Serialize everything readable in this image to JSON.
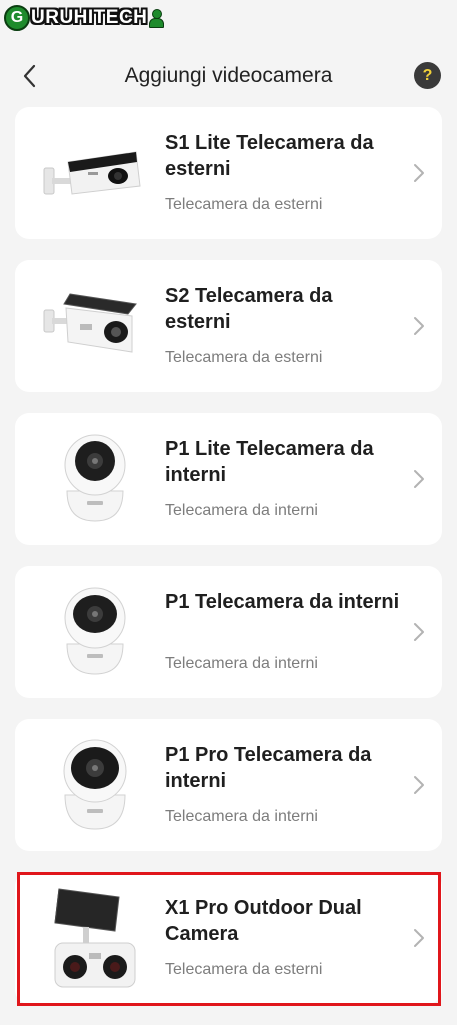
{
  "watermark": {
    "logo_letter": "G",
    "text": "URUHITECH"
  },
  "header": {
    "title": "Aggiungi videocamera",
    "help_label": "?"
  },
  "cameras": [
    {
      "name": "S1 Lite Telecamera da esterni",
      "type": "Telecamera da esterni",
      "icon": "outdoor-bullet-camera-icon"
    },
    {
      "name": "S2 Telecamera da esterni",
      "type": "Telecamera da esterni",
      "icon": "outdoor-solar-bullet-camera-icon"
    },
    {
      "name": "P1 Lite Telecamera da interni",
      "type": "Telecamera da interni",
      "icon": "indoor-pan-tilt-camera-icon"
    },
    {
      "name": "P1 Telecamera da interni",
      "type": "Telecamera da interni",
      "icon": "indoor-pan-tilt-camera-icon"
    },
    {
      "name": "P1 Pro Telecamera da interni",
      "type": "Telecamera da interni",
      "icon": "indoor-pan-tilt-camera-icon"
    },
    {
      "name": "X1 Pro Outdoor Dual Camera",
      "type": "Telecamera da esterni",
      "icon": "solar-dual-lens-camera-icon"
    }
  ],
  "colors": {
    "highlight_border": "#e0161b",
    "help_icon_bg": "#3a3a3a",
    "help_icon_fg": "#f2d23a"
  }
}
